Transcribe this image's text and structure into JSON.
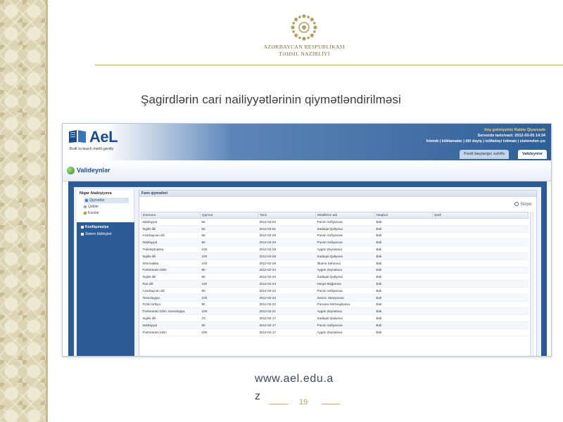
{
  "ministry": {
    "line1": "AZƏRBAYCAN RESPUBLİKASI",
    "line2": "TƏHSİL NAZİRLİYİ"
  },
  "slide": {
    "title": "Şagirdlərin cari nailiyyətlərinin qiymətləndirilməsi",
    "url": "www.ael.edu.a",
    "url_wrap": "z",
    "page_number": "19"
  },
  "app": {
    "logo_text": "AeL",
    "logo_tagline": "Built to teach intelli-gently",
    "greeting": "Xoş gəlmişsiniz Rabilə Qiyarzadə",
    "server_date": "Serverdə tarix/vaxt: 2012-03-05 14:34",
    "top_links": "kömək | köklamalar | dili dəyiş | istifadəçi təlimatı | sistemdən çıx",
    "tabs": [
      {
        "label": "Fərdi başlanğıc səhifə"
      },
      {
        "label": "Valideynlər"
      }
    ],
    "page_title": "Valideynlər",
    "nav": {
      "head": "Nigar Atakişiyeva",
      "items": [
        "Qiymətlər",
        "Qəblər",
        "Kurslar"
      ],
      "section_items": [
        "Konfiqurasiya",
        "Sistem bildirişləri"
      ]
    },
    "grid": {
      "title": "Fənn qiymətləri",
      "search_label": "Süzgəc",
      "columns": [
        "Dərsənə",
        "Qiymət",
        "Tarix",
        "Müəllimin adı",
        "Məqbul",
        "Şərh"
      ],
      "rows": [
        [
          "Ədəbiyyat",
          "90",
          "2012-03-02",
          "Pərvin Səfiyarova",
          "Bəli",
          ""
        ],
        [
          "İngilis dili",
          "52",
          "2012-03-01",
          "Sədaqət Quliyeva",
          "Bəli",
          ""
        ],
        [
          "Azərbaycan dili",
          "55",
          "2012-02-29",
          "Pərvin Səfiyarova",
          "Bəli",
          ""
        ],
        [
          "Ədəbiyyat",
          "50",
          "2012-02-29",
          "Pərvin Səfiyarova",
          "Bəli",
          ""
        ],
        [
          "Təbiətşünaslıq",
          "100",
          "2012-02-28",
          "Aygün Zeynalova",
          "Bəli",
          ""
        ],
        [
          "İngilis dili",
          "100",
          "2012-02-28",
          "Sədaqət Quliyeva",
          "Bəli",
          ""
        ],
        [
          "İnformatika",
          "100",
          "2012-02-26",
          "İlhamə Səfərova",
          "Bəli",
          ""
        ],
        [
          "Fənlərarası təlim",
          "80",
          "2012-02-24",
          "Aygün Zeynalova",
          "Bəli",
          ""
        ],
        [
          "İngilis dili",
          "80",
          "2012-02-23",
          "Sədaqət Quliyeva",
          "Bəli",
          ""
        ],
        [
          "Rus dili",
          "100",
          "2012-02-23",
          "Nərgiz Bağarova",
          "Bəli",
          ""
        ],
        [
          "Azərbaycan dili",
          "80",
          "2012-02-22",
          "Pərvin Səfiyarova",
          "Bəli",
          ""
        ],
        [
          "Texnologiya",
          "100",
          "2012-02-22",
          "Sevinc Hüseynova",
          "Bəli",
          ""
        ],
        [
          "Fiziki tərbiyə",
          "90",
          "2012-02-22",
          "Pərvanə Mirzəquliyeva",
          "Bəli",
          ""
        ],
        [
          "Fənlərarası təlim, texnologiya",
          "100",
          "2012-02-21",
          "Aygün Zeynalova",
          "Bəli",
          ""
        ],
        [
          "İngilis dili",
          "70",
          "2012-02-17",
          "Sədaqət Quliyeva",
          "Bəli",
          ""
        ],
        [
          "Ədəbiyyat",
          "80",
          "2012-02-17",
          "Pərvin Səfiyarova",
          "Bəli",
          ""
        ],
        [
          "Fənlərarası təlim",
          "100",
          "2012-02-17",
          "Aygün Zeynalova",
          "Bəli",
          ""
        ]
      ]
    }
  },
  "colors": {
    "accent_blue": "#2c5a94",
    "gold": "#b9a976"
  }
}
